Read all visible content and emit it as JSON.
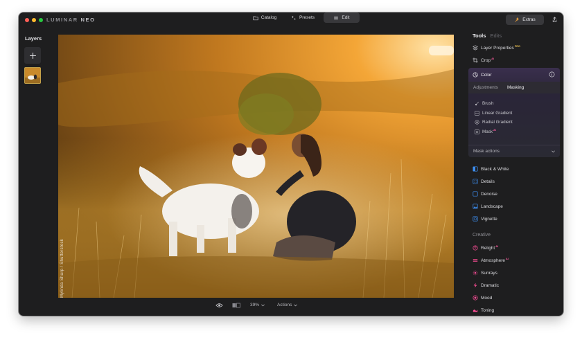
{
  "app": {
    "brand_primary": "LUMINAR",
    "brand_secondary": "NEO"
  },
  "topbar": {
    "modes": [
      {
        "label": "Catalog",
        "icon": "folder-icon",
        "active": false
      },
      {
        "label": "Presets",
        "icon": "sparkle-icon",
        "active": false
      },
      {
        "label": "Edit",
        "icon": "sliders-icon",
        "active": true
      }
    ],
    "extras_label": "Extras",
    "share_icon": "share-icon"
  },
  "layers": {
    "title": "Layers",
    "add_icon": "plus-icon"
  },
  "canvas": {
    "watermark": "Mylinda Sharp / Shutterstock"
  },
  "bottombar": {
    "zoom": "39%",
    "actions_label": "Actions"
  },
  "tools_panel": {
    "tab_active": "Tools",
    "tab_inactive": "Edits",
    "layer_properties": {
      "label": "Layer Properties",
      "badge": "PRO"
    },
    "crop": {
      "label": "Crop",
      "badge": "AI"
    },
    "color": {
      "label": "Color",
      "subtabs": [
        "Adjustments",
        "Masking"
      ],
      "active_subtab": "Masking",
      "mask_items": [
        {
          "label": "Brush",
          "icon": "brush-icon"
        },
        {
          "label": "Linear Gradient",
          "icon": "linear-gradient-icon"
        },
        {
          "label": "Radial Gradient",
          "icon": "radial-gradient-icon"
        },
        {
          "label": "Mask",
          "icon": "mask-icon",
          "badge": "AI"
        }
      ],
      "mask_actions": "Mask actions"
    },
    "essentials": [
      {
        "label": "Black & White",
        "color": "#3d8ef0"
      },
      {
        "label": "Details",
        "color": "#3d8ef0"
      },
      {
        "label": "Denoise",
        "color": "#3d8ef0"
      },
      {
        "label": "Landscape",
        "color": "#3d8ef0"
      },
      {
        "label": "Vignette",
        "color": "#3d8ef0"
      }
    ],
    "creative_label": "Creative",
    "creative": [
      {
        "label": "Relight",
        "badge": "AI",
        "color": "#ff4d97"
      },
      {
        "label": "Atmosphere",
        "badge": "AI",
        "color": "#ff4d97"
      },
      {
        "label": "Sunrays",
        "color": "#ff4d97"
      },
      {
        "label": "Dramatic",
        "color": "#ff4d97"
      },
      {
        "label": "Mood",
        "color": "#ff4d97"
      },
      {
        "label": "Toning",
        "color": "#ff4d97"
      }
    ]
  }
}
